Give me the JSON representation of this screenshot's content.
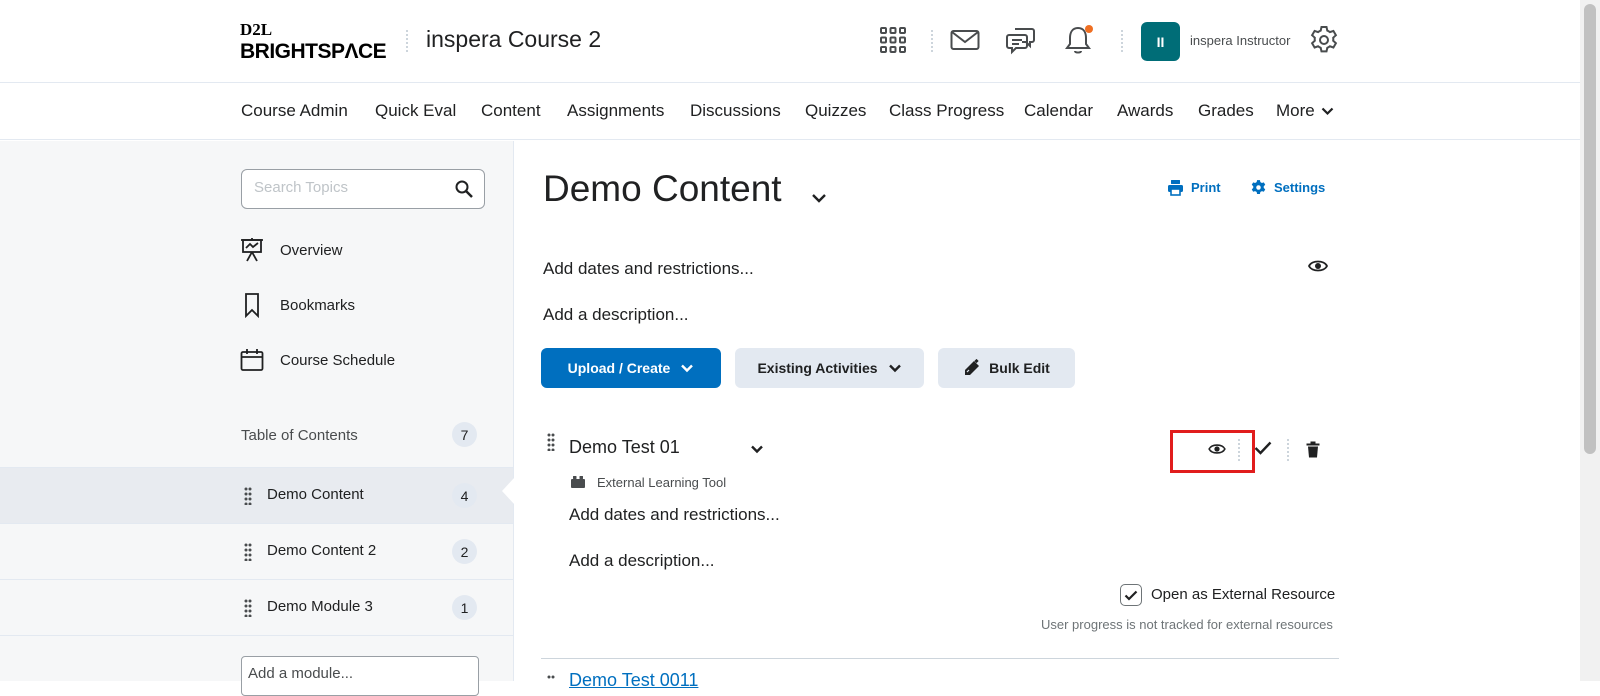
{
  "header": {
    "logo_top": "D2L",
    "logo_main": "BRIGHTSPΛCE",
    "course_title": "inspera Course 2",
    "avatar_initials": "II",
    "user_name": "inspera Instructor",
    "icons": [
      "grid-icon",
      "mail-icon",
      "chat-icon",
      "bell-icon",
      "gear-icon"
    ],
    "notification_color": "#ef6f22",
    "avatar_color": "#006d77"
  },
  "nav": {
    "items": [
      "Course Admin",
      "Quick Eval",
      "Content",
      "Assignments",
      "Discussions",
      "Quizzes",
      "Class Progress",
      "Calendar",
      "Awards",
      "Grades"
    ],
    "more_label": "More"
  },
  "sidebar": {
    "search_placeholder": "Search Topics",
    "links": [
      "Overview",
      "Bookmarks",
      "Course Schedule"
    ],
    "toc_label": "Table of Contents",
    "toc_count": "7",
    "modules": [
      {
        "name": "Demo Content",
        "count": "4",
        "active": true
      },
      {
        "name": "Demo Content 2",
        "count": "2",
        "active": false
      },
      {
        "name": "Demo Module 3",
        "count": "1",
        "active": false
      }
    ],
    "add_module_placeholder": "Add a module..."
  },
  "main": {
    "title": "Demo Content",
    "print_label": "Print",
    "settings_label": "Settings",
    "add_dates": "Add dates and restrictions...",
    "add_description": "Add a description...",
    "upload_create": "Upload / Create",
    "existing_activities": "Existing Activities",
    "bulk_edit": "Bulk Edit",
    "topic": {
      "title": "Demo Test 01",
      "type": "External Learning Tool",
      "add_dates": "Add dates and restrictions...",
      "add_description": "Add a description...",
      "open_external_label": "Open as External Resource",
      "open_external_checked": true,
      "help_text": "User progress is not tracked for external resources"
    },
    "next_topic_title": "Demo Test 0011",
    "accent_color": "#006fbf",
    "highlight_color": "#e11d1d"
  }
}
